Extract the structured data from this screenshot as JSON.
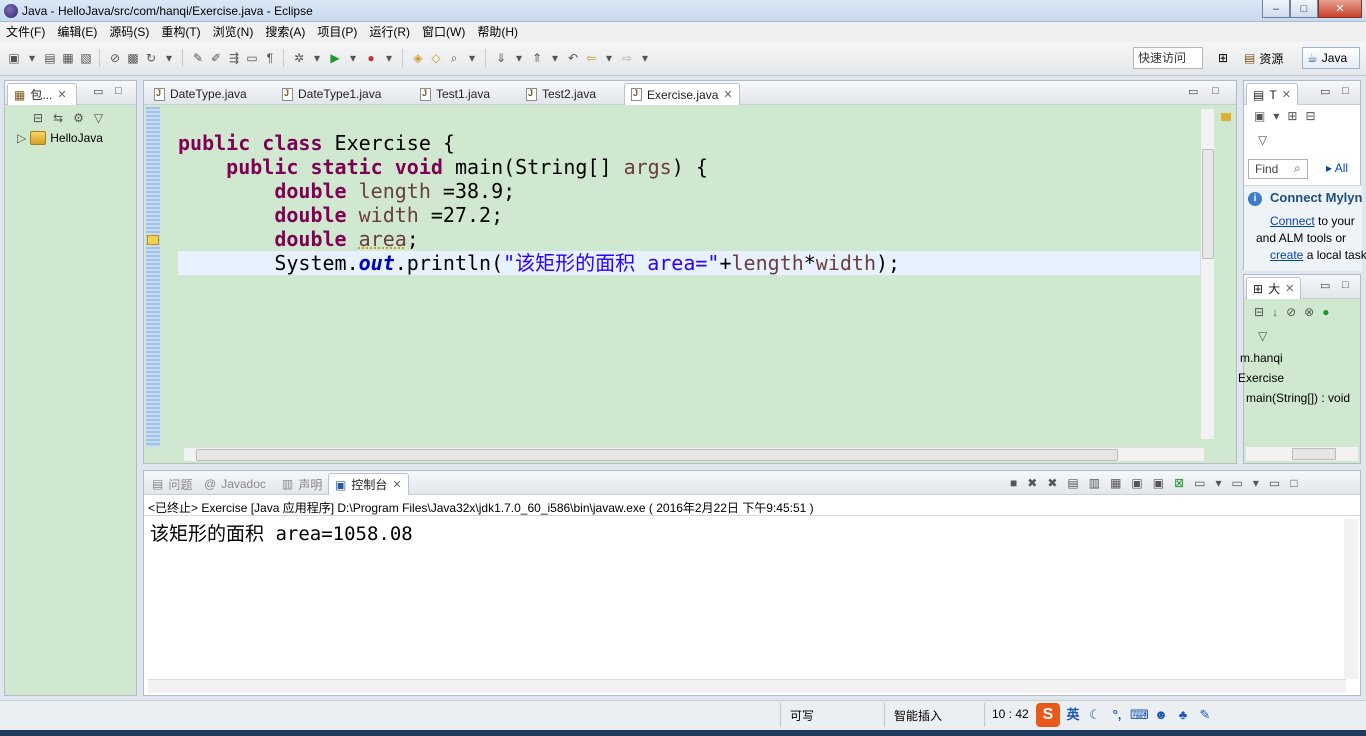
{
  "window": {
    "title": "Java - HelloJava/src/com/hanqi/Exercise.java - Eclipse",
    "minimize": "–",
    "maximize": "□",
    "close": "✕"
  },
  "menu": [
    "文件(F)",
    "编辑(E)",
    "源码(S)",
    "重构(T)",
    "浏览(N)",
    "搜索(A)",
    "项目(P)",
    "运行(R)",
    "窗口(W)",
    "帮助(H)"
  ],
  "toolbar": {
    "quick_access": "快速访问",
    "perspective_resources": "资源",
    "perspective_java": "Java"
  },
  "package_explorer": {
    "tab_label": "包...",
    "project": "HelloJava"
  },
  "editor": {
    "tabs": [
      "DateType.java",
      "DateType1.java",
      "Test1.java",
      "Test2.java",
      "Exercise.java"
    ],
    "active_tab": "Exercise.java",
    "code": {
      "l1_kw1": "public",
      "l1_kw2": "class",
      "l1_name": " Exercise {",
      "l2_kw1": "public",
      "l2_kw2": "static",
      "l2_kw3": "void",
      "l2_rest1": " main(String[] ",
      "l2_var": "args",
      "l2_rest2": ") {",
      "l3_kw": "double",
      "l3_var": "length",
      "l3_rest": " =38.9;",
      "l4_kw": "double",
      "l4_var": "width",
      "l4_rest": " =27.2;",
      "l5_kw": "double",
      "l5_var": "area",
      "l5_rest": ";",
      "l6_a": "System.",
      "l6_fld": "out",
      "l6_b": ".println(",
      "l6_str": "\"该矩形的面积 area=\"",
      "l6_c": "+",
      "l6_var1": "length",
      "l6_d": "*",
      "l6_var2": "width",
      "l6_e": ");"
    }
  },
  "task_panel": {
    "tab_label": "T",
    "find_placeholder": "Find",
    "all_link": "All",
    "mylyn_title": "Connect Mylyn",
    "mylyn_link1": "Connect",
    "mylyn_text1": " to your",
    "mylyn_text2": "and ALM tools or",
    "mylyn_link2": "create",
    "mylyn_text3": " a local task"
  },
  "outline_panel": {
    "tab_label": "大",
    "items": [
      "m.hanqi",
      "Exercise",
      "main(String[]) : void"
    ]
  },
  "bottom_tabs": [
    "问题",
    "Javadoc",
    "声明",
    "控制台"
  ],
  "console": {
    "header": "<已终止> Exercise [Java 应用程序] D:\\Program Files\\Java32x\\jdk1.7.0_60_i586\\bin\\javaw.exe ( 2016年2月22日 下午9:45:51 )",
    "output": "该矩形的面积 area=1058.08"
  },
  "status": {
    "writable": "可写",
    "insert_mode": "智能插入",
    "position": "10 : 42",
    "ime_logo": "S",
    "ime_lang": "英"
  }
}
